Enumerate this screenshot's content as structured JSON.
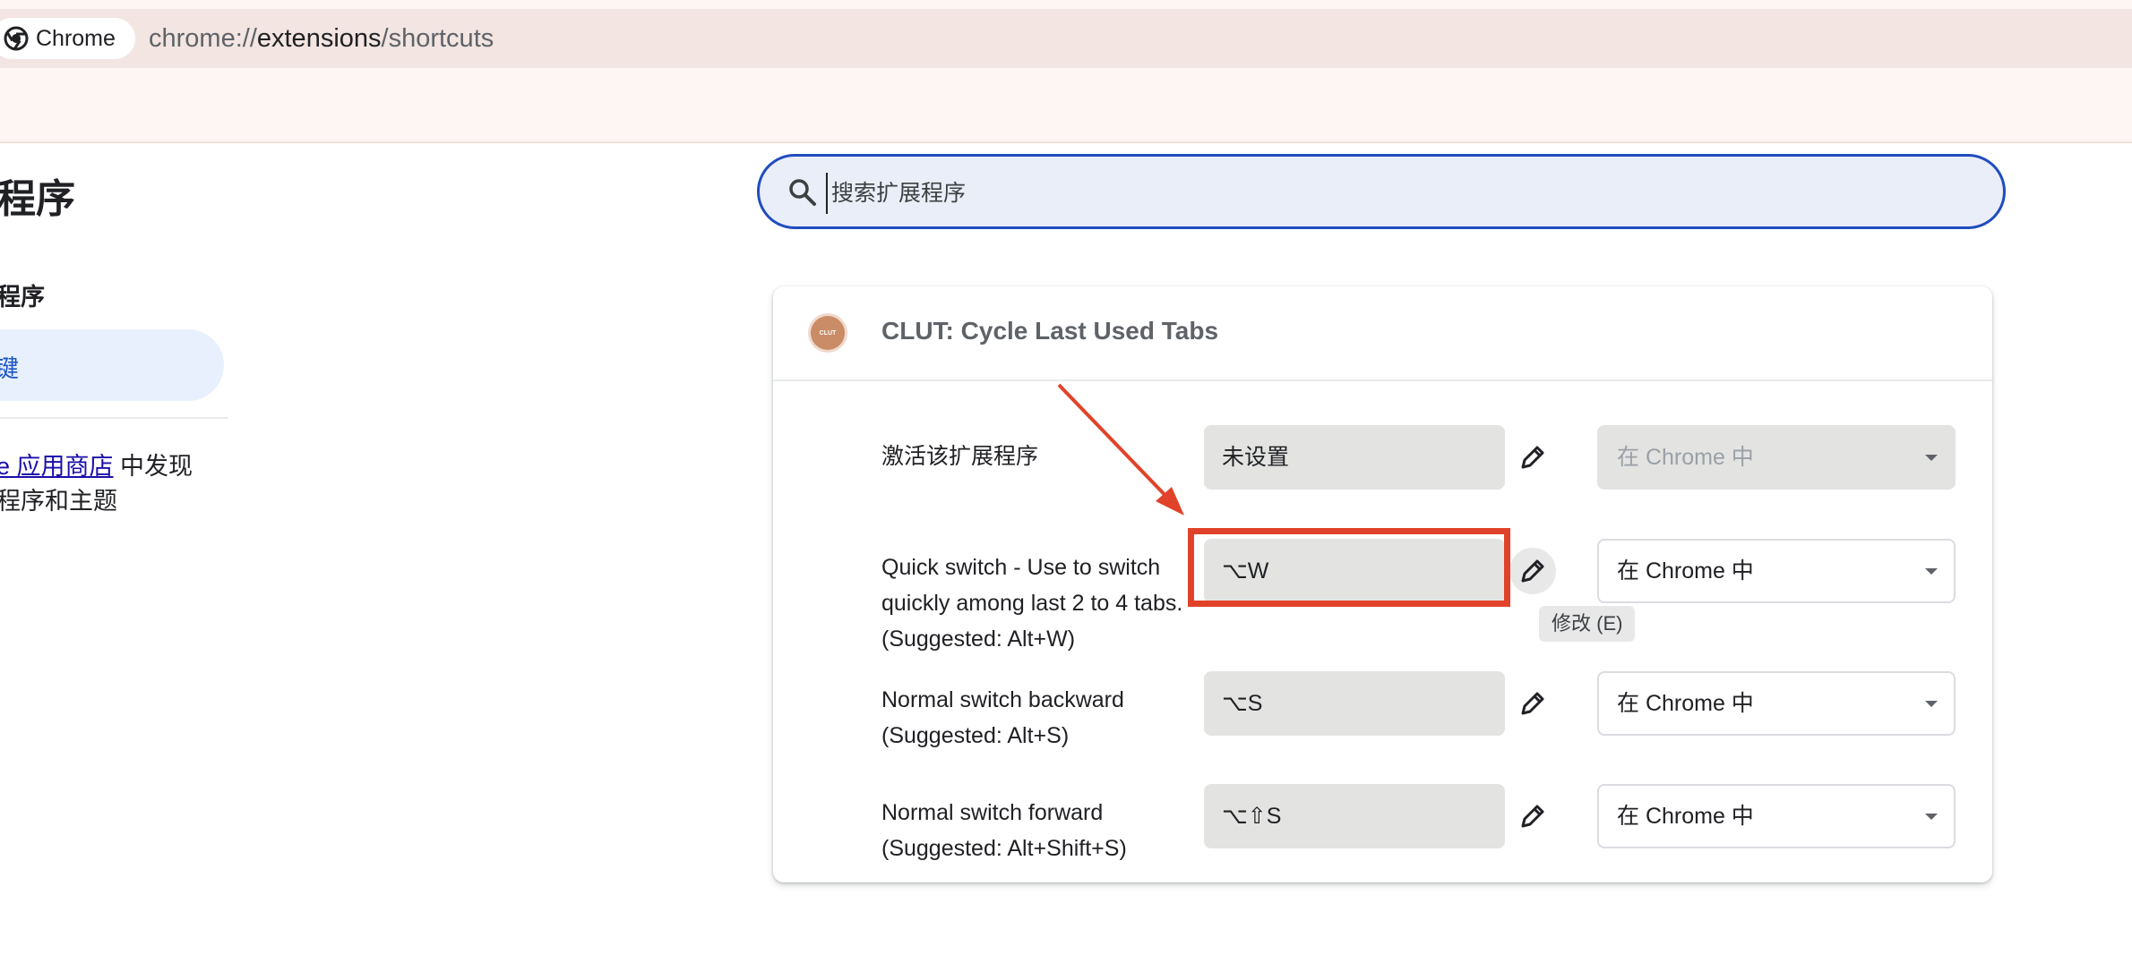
{
  "browser": {
    "chip_label": "Chrome",
    "url_scheme": "chrome://",
    "url_host": "extensions",
    "url_path": "/shortcuts"
  },
  "sidebar": {
    "title": "程序",
    "subtitle": "程序",
    "active_item": "键",
    "store_link": "e 应用商店",
    "store_text_1": " 中发现",
    "store_text_2": "程序和主题"
  },
  "search": {
    "placeholder": "搜索扩展程序",
    "value": ""
  },
  "extension": {
    "logo_text": "CLUT",
    "name": "CLUT: Cycle Last Used Tabs",
    "shortcuts": [
      {
        "label": "激活该扩展程序",
        "key": "未设置",
        "scope": "在 Chrome 中",
        "scope_disabled": true
      },
      {
        "label": "Quick switch - Use to switch quickly among last 2 to 4 tabs. (Suggested: Alt+W)",
        "key": "⌥W",
        "scope": "在 Chrome 中",
        "scope_disabled": false
      },
      {
        "label": "Normal switch backward (Suggested: Alt+S)",
        "key": "⌥S",
        "scope": "在 Chrome 中",
        "scope_disabled": false
      },
      {
        "label": "Normal switch forward (Suggested: Alt+Shift+S)",
        "key": "⌥⇧S",
        "scope": "在 Chrome 中",
        "scope_disabled": false
      }
    ]
  },
  "tooltip": "修改 (E)",
  "annotation": {
    "color": "#e0432a"
  },
  "colors": {
    "accent": "#1f4cbf",
    "link": "#1a0dab",
    "active_bg": "#e8f0fe"
  }
}
